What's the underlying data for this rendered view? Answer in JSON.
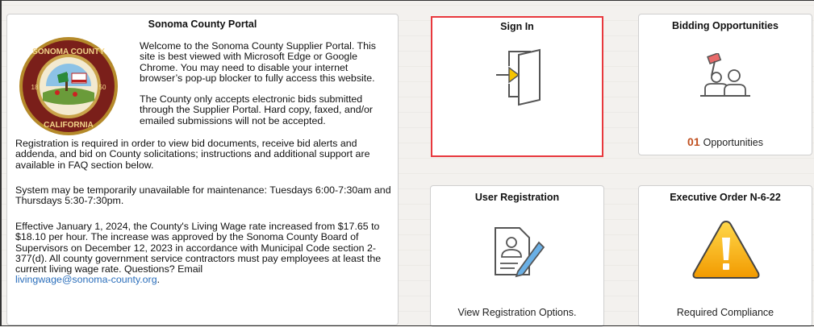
{
  "portal": {
    "title": "Sonoma County Portal",
    "seal_text": {
      "top": "SONOMA COUNTY",
      "bottom": "CALIFORNIA",
      "left_year": "18",
      "right_year": "50",
      "center": "AGRICULTURE INDUSTRY RECREATION"
    },
    "welcome_1": "Welcome to the Sonoma County Supplier Portal. This site is best viewed with Microsoft Edge or Google Chrome. You may need to disable your internet browser’s pop-up blocker to fully access this website.",
    "welcome_2": "The County only accepts electronic bids submitted through the Supplier Portal. Hard copy, faxed, and/or emailed submissions will not be accepted.",
    "registration": "Registration is required in order to view bid documents, receive bid alerts and addenda, and bid on County solicitations; instructions and additional support are available in FAQ section below.",
    "maintenance": "System may be temporarily unavailable for maintenance: Tuesdays 6:00-7:30am and Thursdays 5:30-7:30pm.",
    "living_wage": "Effective January 1, 2024, the County's Living Wage rate increased from $17.65 to $18.10 per hour. The increase was approved by the Sonoma County Board of Supervisors on December 12, 2023 in accordance with Municipal Code section 2-377(d). All county government service contractors must pay employees at least the current living wage rate. Questions? Email",
    "email": "livingwage@sonoma-county.org",
    "email_suffix": "."
  },
  "signin": {
    "title": "Sign In",
    "icon": "sign-in-door-icon"
  },
  "bidding": {
    "title": "Bidding Opportunities",
    "count": "01",
    "count_label": "Opportunities",
    "icon": "auction-bidders-icon"
  },
  "user_registration": {
    "title": "User Registration",
    "footer": "View Registration Options.",
    "icon": "registration-form-icon"
  },
  "executive_order": {
    "title": "Executive Order N-6-22",
    "footer": "Required Compliance",
    "icon": "warning-icon"
  },
  "colors": {
    "highlight_border": "#e8383d",
    "link": "#2a6ebb",
    "count": "#c05020",
    "warning": "#f5a800"
  }
}
